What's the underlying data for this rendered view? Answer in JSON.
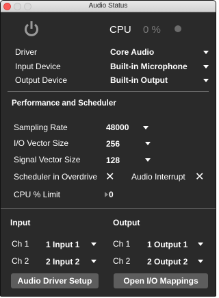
{
  "window": {
    "title": "Audio Status"
  },
  "cpu": {
    "label": "CPU",
    "value": "0 %"
  },
  "driver": {
    "label": "Driver",
    "value": "Core Audio"
  },
  "input_device": {
    "label": "Input Device",
    "value": "Built-in Microphone"
  },
  "output_device": {
    "label": "Output Device",
    "value": "Built-in Output"
  },
  "performance": {
    "heading": "Performance and Scheduler",
    "sampling_rate": {
      "label": "Sampling Rate",
      "value": "48000"
    },
    "io_vector_size": {
      "label": "I/O Vector Size",
      "value": "256"
    },
    "signal_vector_size": {
      "label": "Signal Vector Size",
      "value": "128"
    },
    "scheduler_overdrive": {
      "label": "Scheduler in Overdrive",
      "checked": false
    },
    "audio_interrupt": {
      "label": "Audio Interrupt",
      "checked": false
    },
    "cpu_limit": {
      "label": "CPU % Limit",
      "value": "0"
    }
  },
  "io": {
    "input_heading": "Input",
    "output_heading": "Output",
    "inputs": [
      {
        "channel": "Ch 1",
        "value": "1 Input 1"
      },
      {
        "channel": "Ch 2",
        "value": "2 Input 2"
      }
    ],
    "outputs": [
      {
        "channel": "Ch 1",
        "value": "1 Output 1"
      },
      {
        "channel": "Ch 2",
        "value": "2 Output 2"
      }
    ]
  },
  "buttons": {
    "driver_setup": "Audio Driver Setup",
    "io_mappings": "Open I/O Mappings"
  },
  "colors": {
    "background": "#2a2a2a",
    "button": "#5d5d5d",
    "close_button": "#fc5b57",
    "dim_text": "#7a7a7a"
  }
}
